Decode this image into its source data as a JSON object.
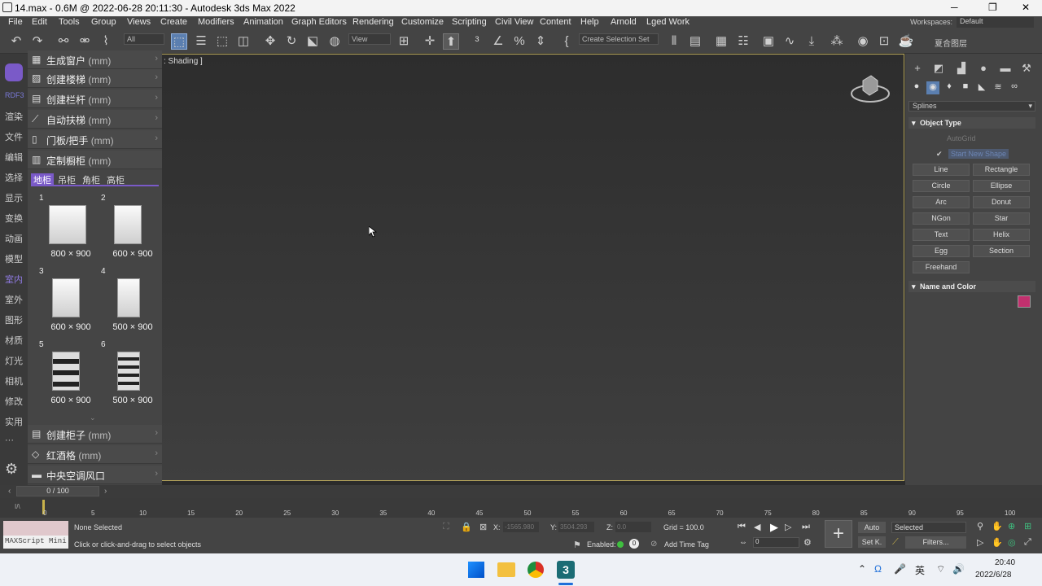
{
  "titlebar": {
    "title": "14.max - 0.6M @ 2022-06-28 20:11:30 - Autodesk 3ds Max 2022",
    "minimize": "─",
    "maximize": "❐",
    "close": "✕"
  },
  "menu": [
    "File",
    "Edit",
    "Tools",
    "Group",
    "Views",
    "Create",
    "Modifiers",
    "Animation",
    "Graph Editors",
    "Rendering",
    "Customize",
    "Scripting",
    "Civil View",
    "Content",
    "Help",
    "Arnold",
    "Lged Work"
  ],
  "workspaces_label": "Workspaces:",
  "workspaces_value": "Default",
  "toolbar": {
    "filter": "All",
    "view": "View",
    "selection_set": "Create Selection Set",
    "layer_text": "夏合图层"
  },
  "leftcol": [
    "RDF3",
    "渲染",
    "文件",
    "编辑",
    "选择",
    "显示",
    "变换",
    "动画",
    "模型",
    "室内",
    "室外",
    "图形",
    "材质",
    "灯光",
    "相机",
    "修改",
    "实用",
    "···"
  ],
  "plugin": {
    "rows_top": [
      {
        "icon": "▦",
        "label": "生成窗户",
        "unit": "(mm)"
      },
      {
        "icon": "▨",
        "label": "创建楼梯",
        "unit": "(mm)"
      },
      {
        "icon": "▤",
        "label": "创建栏杆",
        "unit": "(mm)"
      },
      {
        "icon": "⟋",
        "label": "自动扶梯",
        "unit": "(mm)"
      },
      {
        "icon": "▯",
        "label": "门板/把手",
        "unit": "(mm)"
      },
      {
        "icon": "▥",
        "label": "定制橱柜",
        "unit": "(mm)"
      }
    ],
    "tabs": [
      "地柜",
      "吊柜",
      "角柜",
      "高柜"
    ],
    "cards": [
      {
        "num": "1",
        "dim": "800 × 900"
      },
      {
        "num": "2",
        "dim": "600 × 900"
      },
      {
        "num": "3",
        "dim": "600 × 900"
      },
      {
        "num": "4",
        "dim": "500 × 900"
      },
      {
        "num": "5",
        "dim": "600 × 900"
      },
      {
        "num": "6",
        "dim": "500 × 900"
      }
    ],
    "rows_bottom": [
      {
        "icon": "▤",
        "label": "创建柜子",
        "unit": "(mm)"
      },
      {
        "icon": "◇",
        "label": "红酒格",
        "unit": "(mm)"
      },
      {
        "icon": "▬",
        "label": "中央空调风口",
        "unit": ""
      }
    ]
  },
  "viewport": {
    "label": ": Shading ]"
  },
  "rpanel": {
    "category": "Splines",
    "object_type": "Object Type",
    "autogrid": "AutoGrid",
    "start_new_shape": "Start New Shape",
    "buttons": [
      "Line",
      "Rectangle",
      "Circle",
      "Ellipse",
      "Arc",
      "Donut",
      "NGon",
      "Star",
      "Text",
      "Helix",
      "Egg",
      "Section",
      "Freehand"
    ],
    "name_color": "Name and Color",
    "color": "#c2306e"
  },
  "timeline": {
    "frame": "0 / 100",
    "ticks": [
      "0",
      "5",
      "10",
      "15",
      "20",
      "25",
      "30",
      "35",
      "40",
      "45",
      "50",
      "55",
      "60",
      "65",
      "70",
      "75",
      "80",
      "85",
      "90",
      "95",
      "100"
    ]
  },
  "status": {
    "maxscript": "MAXScript Mini",
    "selected": "None Selected",
    "hint": "Click or click-and-drag to select objects",
    "x_label": "X:",
    "x_val": "-1565.980",
    "y_label": "Y:",
    "y_val": "3504.293",
    "z_label": "Z:",
    "z_val": "0.0",
    "grid": "Grid = 100.0",
    "enabled": "Enabled:",
    "add_time_tag": "Add Time Tag",
    "auto": "Auto",
    "selected_dd": "Selected",
    "setk": "Set K.",
    "filters": "Filters...",
    "frame_val": "0"
  },
  "taskbar": {
    "time": "20:40",
    "date": "2022/6/28",
    "ime": "英"
  }
}
